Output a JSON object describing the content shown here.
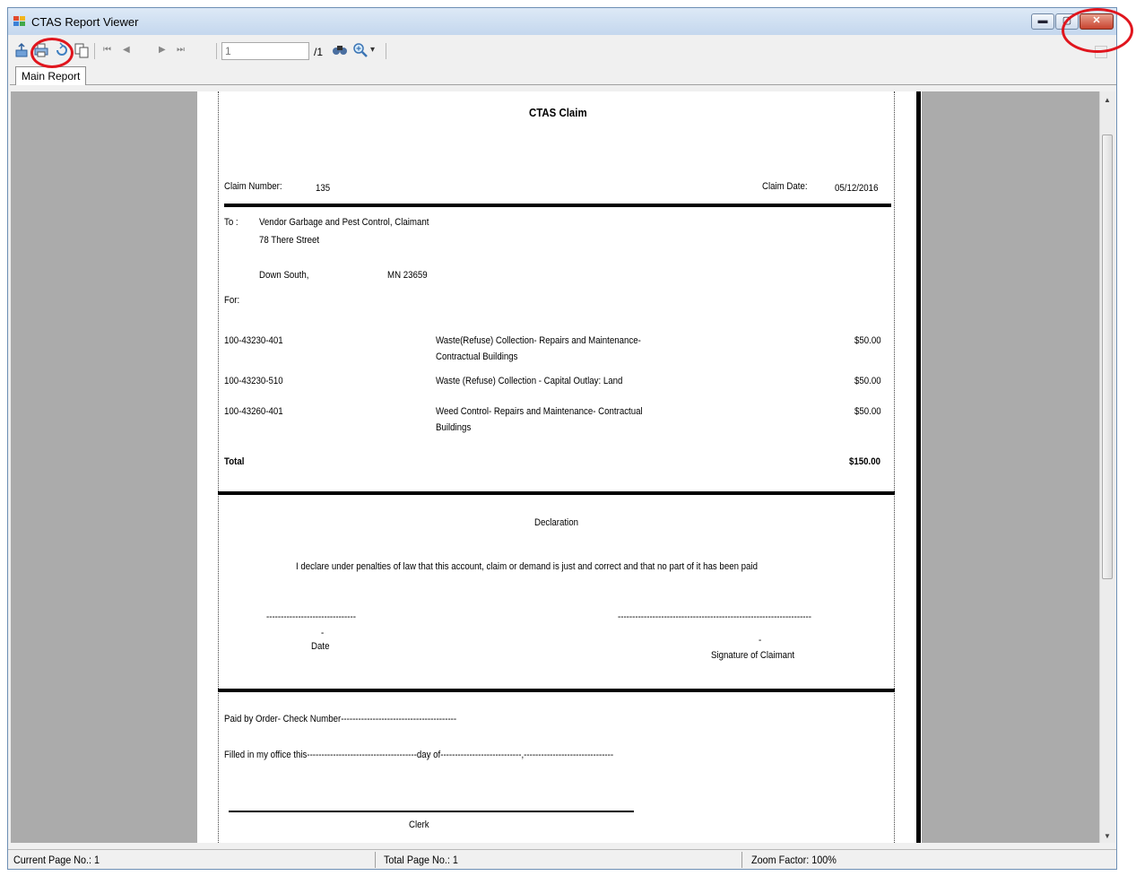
{
  "window": {
    "title": "CTAS Report Viewer",
    "min_glyph": "▬",
    "max_glyph": "▢",
    "close_glyph": "✕"
  },
  "toolbar": {
    "page_value": "1",
    "page_total": "/1",
    "icons": [
      "export-icon",
      "print-icon",
      "refresh-icon",
      "copy-icon",
      "first-page-icon",
      "prev-page-icon",
      "next-page-icon",
      "last-page-icon",
      "find-icon",
      "zoom-icon"
    ],
    "nav": {
      "first": "⏮",
      "prev": "◀",
      "next": "▶",
      "last": "⏭",
      "dropdown": "▾"
    }
  },
  "tabs": {
    "main": "Main Report"
  },
  "report": {
    "title": "CTAS Claim",
    "claim_number_label": "Claim Number:",
    "claim_number": "135",
    "claim_date_label": "Claim Date:",
    "claim_date": "05/12/2016",
    "to_label": "To :",
    "vendor": "Vendor Garbage and Pest Control, Claimant",
    "address": "78 There Street",
    "city": "Down South,",
    "state_zip": "MN   23659",
    "for_label": "For:",
    "lines": [
      {
        "account": "100-43230-401",
        "desc1": "Waste(Refuse) Collection- Repairs and Maintenance-",
        "desc2": "Contractual Buildings",
        "amount": "$50.00"
      },
      {
        "account": "100-43230-510",
        "desc1": "Waste (Refuse) Collection - Capital Outlay: Land",
        "desc2": "",
        "amount": "$50.00"
      },
      {
        "account": "100-43260-401",
        "desc1": "Weed Control- Repairs and Maintenance- Contractual",
        "desc2": "Buildings",
        "amount": "$50.00"
      }
    ],
    "total_label": "Total",
    "total": "$150.00",
    "declaration_title": "Declaration",
    "declaration_text": "I declare under penalties of law that this account, claim or demand is just and correct and that no part of it has been paid",
    "date_dashes": "-------------------------------",
    "sig_dashes": "-------------------------------------------------------------------",
    "dash": "-",
    "date_label": "Date",
    "signature_label": "Signature of Claimant",
    "paid_by": "Paid by Order- Check Number----------------------------------------",
    "filled_in": "Filled in my office this--------------------------------------day of----------------------------,-------------------------------",
    "clerk_label": "Clerk"
  },
  "status": {
    "current_page": "Current Page No.: 1",
    "total_pages": "Total Page No.: 1",
    "zoom": "Zoom Factor: 100%"
  },
  "colors": {
    "highlight_ring": "#e0161e",
    "viewer_background": "#ababab",
    "close_button": "#c84430"
  }
}
